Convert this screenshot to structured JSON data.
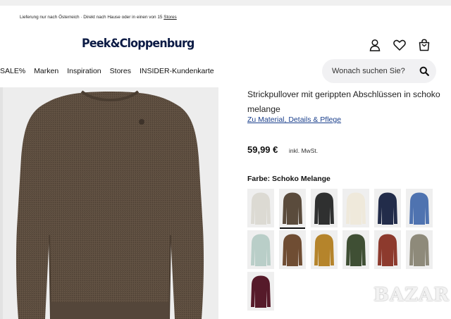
{
  "shipping": {
    "text": "Lieferung nur nach Österreich · Direkt nach Hause oder in einen von 15 ",
    "link": "Stores"
  },
  "brand": {
    "logo": "Peek&Cloppenburg"
  },
  "header_icons": [
    "user-icon",
    "heart-icon",
    "bag-icon"
  ],
  "nav": [
    "SALE%",
    "Marken",
    "Inspiration",
    "Stores",
    "INSIDER-Kundenkarte"
  ],
  "search": {
    "placeholder": "Wonach suchen Sie?"
  },
  "product": {
    "title": "Strickpullover mit gerippten Abschlüssen in schoko melange",
    "details_link": "Zu Material, Details & Pflege",
    "price": "59,99 €",
    "vat": "inkl. MwSt.",
    "color_label": "Farbe: Schoko Melange",
    "main_color": "#5b4c3e"
  },
  "swatches": [
    {
      "color": "#dcdad3",
      "selected": false
    },
    {
      "color": "#5a4b3c",
      "selected": true
    },
    {
      "color": "#2f3030",
      "selected": false
    },
    {
      "color": "#efe9db",
      "selected": false
    },
    {
      "color": "#222c4a",
      "selected": false
    },
    {
      "color": "#4f73b0",
      "selected": false
    },
    {
      "color": "#b9cec8",
      "selected": false
    },
    {
      "color": "#6f4d33",
      "selected": false
    },
    {
      "color": "#b5842b",
      "selected": false
    },
    {
      "color": "#3f4f34",
      "selected": false
    },
    {
      "color": "#8d3a2d",
      "selected": false
    },
    {
      "color": "#8e8a7a",
      "selected": false
    },
    {
      "color": "#561a2a",
      "selected": false
    }
  ],
  "watermark": "BAZAR"
}
